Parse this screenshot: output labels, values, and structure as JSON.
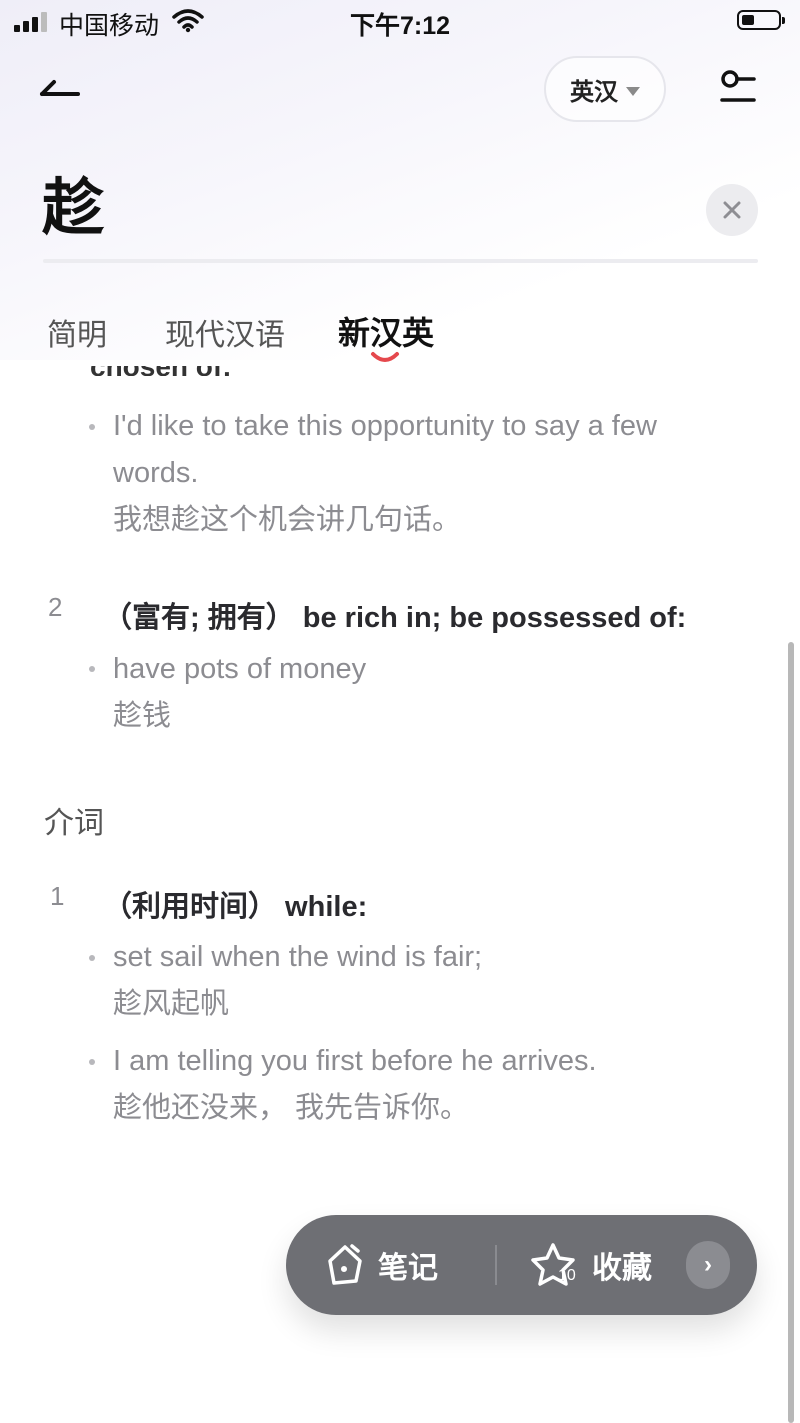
{
  "status_bar": {
    "carrier": "中国移动",
    "time": "下午7:12"
  },
  "header": {
    "dict_selector": "英汉",
    "headword": "趁"
  },
  "tabs": [
    {
      "label": "简明",
      "active": false
    },
    {
      "label": "现代汉语",
      "active": false
    },
    {
      "label": "新汉英",
      "active": true
    }
  ],
  "entries": {
    "clipped_heading": "chosen of:",
    "example_1": {
      "en_line1": "I'd like to take this opportunity to say a few",
      "en_line2": "words.",
      "zh": "我想趁这个机会讲几句话。"
    },
    "sense_2": {
      "num": "2",
      "def": "（富有; 拥有） be rich in; be possessed of:",
      "example": {
        "en": "have pots of money",
        "zh": "趁钱"
      }
    },
    "pos_prep": "介词",
    "prep_sense_1": {
      "num": "1",
      "def": "（利用时间） while:",
      "examples": [
        {
          "en": "set sail when the wind is fair;",
          "zh": "趁风起帆"
        },
        {
          "en": "I am telling you first before he arrives.",
          "zh": "趁他还没来， 我先告诉你。"
        }
      ]
    }
  },
  "action_bar": {
    "note_label": "笔记",
    "favorite_label": "收藏",
    "favorite_count": "10",
    "more_glyph": "›"
  },
  "colors": {
    "accent": "#e5484d",
    "action_bar_bg": "#6e6f74"
  }
}
